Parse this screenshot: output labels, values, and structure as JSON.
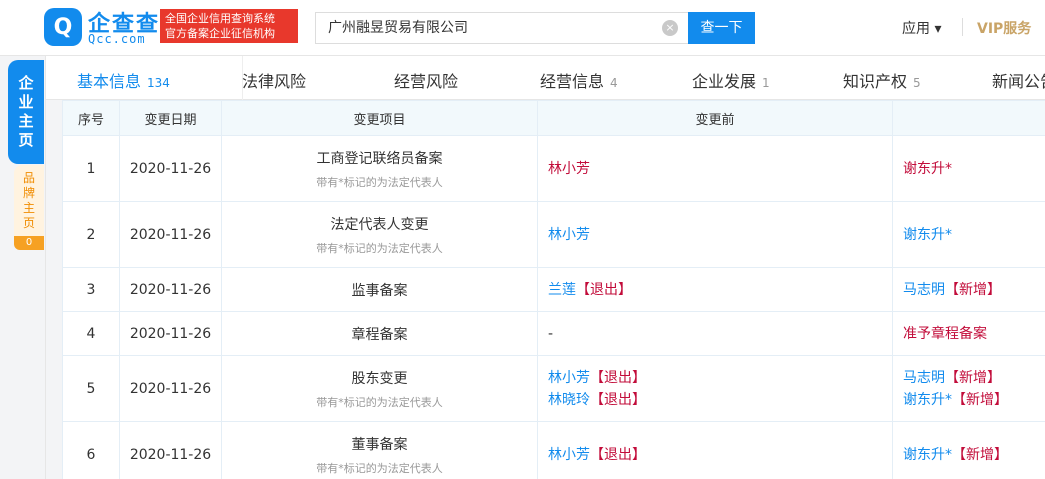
{
  "header": {
    "logo_glyph": "Q",
    "brand": "企查查",
    "brand_sub": "Qcc.com",
    "badge_line1": "全国企业信用查询系统",
    "badge_line2": "官方备案企业征信机构",
    "search_value": "广州融昱贸易有限公司",
    "search_button": "查一下",
    "apps_label": "应用 ▾",
    "vip_label": "VIP服务"
  },
  "sidebar": {
    "main_label": "企业主页",
    "brand_label": "品牌主页",
    "brand_count": "0"
  },
  "tabs": [
    {
      "label": "基本信息",
      "count": "134",
      "active": true
    },
    {
      "label": "法律风险",
      "count": ""
    },
    {
      "label": "经营风险",
      "count": ""
    },
    {
      "label": "经营信息",
      "count": "4"
    },
    {
      "label": "企业发展",
      "count": "1"
    },
    {
      "label": "知识产权",
      "count": "5"
    },
    {
      "label": "新闻公告",
      "count": ""
    }
  ],
  "table": {
    "headers": [
      "序号",
      "变更日期",
      "变更项目",
      "变更前",
      ""
    ],
    "rows": [
      {
        "no": "1",
        "date": "2020-11-26",
        "item": "工商登记联络员备案",
        "note": "带有*标记的为法定代表人",
        "before": [
          {
            "text": "林小芳",
            "tag": ""
          }
        ],
        "after": [
          {
            "text": "谢东升*",
            "tag": ""
          }
        ]
      },
      {
        "no": "2",
        "date": "2020-11-26",
        "item": "法定代表人变更",
        "note": "带有*标记的为法定代表人",
        "before": [
          {
            "text": "林小芳",
            "tag": ""
          }
        ],
        "after": [
          {
            "text": "谢东升*",
            "tag": ""
          }
        ]
      },
      {
        "no": "3",
        "date": "2020-11-26",
        "item": "监事备案",
        "note": "",
        "before": [
          {
            "text": "兰莲",
            "tag": "【退出】"
          }
        ],
        "after": [
          {
            "text": "马志明",
            "tag": "【新增】"
          }
        ]
      },
      {
        "no": "4",
        "date": "2020-11-26",
        "item": "章程备案",
        "note": "",
        "before": [
          {
            "text": "-",
            "tag": ""
          }
        ],
        "after": [
          {
            "text": "准予章程备案",
            "tag": ""
          }
        ]
      },
      {
        "no": "5",
        "date": "2020-11-26",
        "item": "股东变更",
        "note": "带有*标记的为法定代表人",
        "before": [
          {
            "text": "林小芳",
            "tag": "【退出】"
          },
          {
            "text": "林晓玲",
            "tag": "【退出】"
          }
        ],
        "after": [
          {
            "text": "马志明",
            "tag": "【新增】"
          },
          {
            "text": "谢东升*",
            "tag": "【新增】"
          }
        ]
      },
      {
        "no": "6",
        "date": "2020-11-26",
        "item": "董事备案",
        "note": "带有*标记的为法定代表人",
        "before": [
          {
            "text": "林小芳",
            "tag": "【退出】"
          }
        ],
        "after": [
          {
            "text": "谢东升*",
            "tag": "【新增】"
          }
        ]
      }
    ]
  },
  "colors": {
    "accent": "#128bed",
    "red": "#c20c3a",
    "badge": "#e8382c"
  }
}
